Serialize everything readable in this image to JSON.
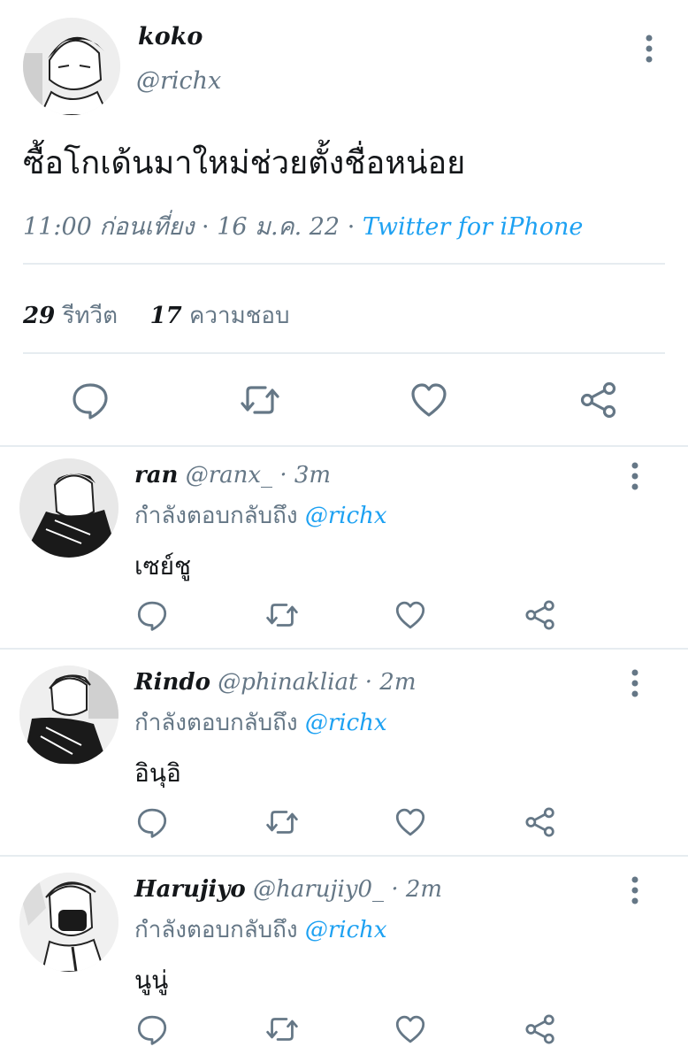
{
  "colors": {
    "accent": "#1da1f2",
    "muted": "#657786",
    "text": "#14171a",
    "divider": "#e6ecf0"
  },
  "main": {
    "author": {
      "name": "koko",
      "handle": "@richx"
    },
    "text": "ซื้อโกเด้นมาใหม่ช่วยตั้งชื่อหน่อย",
    "meta": {
      "time": "11:00 ก่อนเที่ยง",
      "sep1": " · ",
      "date": "16 ม.ค. 22",
      "sep2": " · ",
      "source": "Twitter for iPhone"
    },
    "stats": {
      "retweets": "29",
      "retweets_label": "รีทวีต",
      "likes": "17",
      "likes_label": "ความชอบ"
    },
    "actions": [
      "reply-icon",
      "retweet-icon",
      "like-icon",
      "share-icon"
    ]
  },
  "replies": [
    {
      "name": "ran",
      "handle": "@ranx_",
      "time": "· 3m",
      "replying_label": "กำลังตอบกลับถึง",
      "replying_to": "@richx",
      "text": "เซย์ชู"
    },
    {
      "name": "Rindo",
      "handle": "@phinakliat",
      "time": "· 2m",
      "replying_label": "กำลังตอบกลับถึง",
      "replying_to": "@richx",
      "text": "อินุอิ"
    },
    {
      "name": "Harujiyo",
      "handle": "@harujiy0_",
      "time": "· 2m",
      "replying_label": "กำลังตอบกลับถึง",
      "replying_to": "@richx",
      "text": "นูนู่"
    }
  ]
}
